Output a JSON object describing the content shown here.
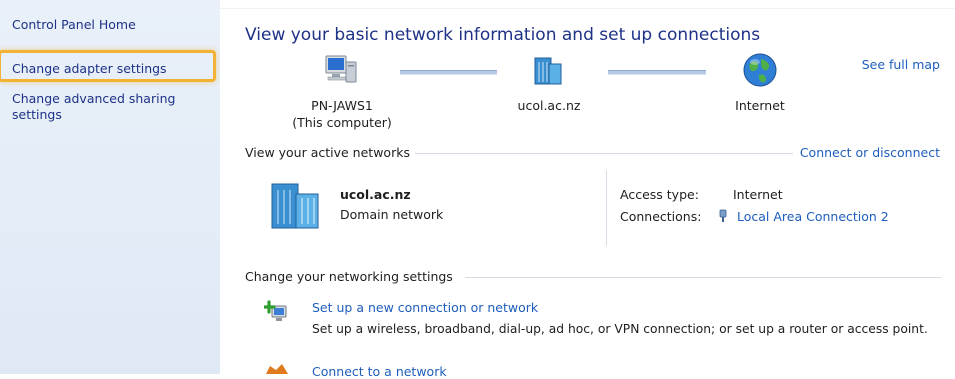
{
  "sidebar": {
    "home": "Control Panel Home",
    "change_adapter": "Change adapter settings",
    "change_sharing_line1": "Change advanced sharing",
    "change_sharing_line2": "settings"
  },
  "main": {
    "title": "View your basic network information and set up connections",
    "see_full_map": "See full map",
    "map": {
      "computer_name": "PN-JAWS1",
      "computer_sub": "(This computer)",
      "domain": "ucol.ac.nz",
      "internet": "Internet"
    },
    "active_networks": {
      "label": "View your active networks",
      "connect_disconnect": "Connect or disconnect",
      "network_name": "ucol.ac.nz",
      "network_type": "Domain network",
      "access_type_label": "Access type:",
      "access_type_value": "Internet",
      "connections_label": "Connections:",
      "connection_value": "Local Area Connection 2"
    },
    "change_settings": {
      "label": "Change your networking settings",
      "new_connection_title": "Set up a new connection or network",
      "new_connection_desc": "Set up a wireless, broadband, dial-up, ad hoc, or VPN connection; or set up a router or access point.",
      "connect_to_network": "Connect to a network"
    }
  }
}
